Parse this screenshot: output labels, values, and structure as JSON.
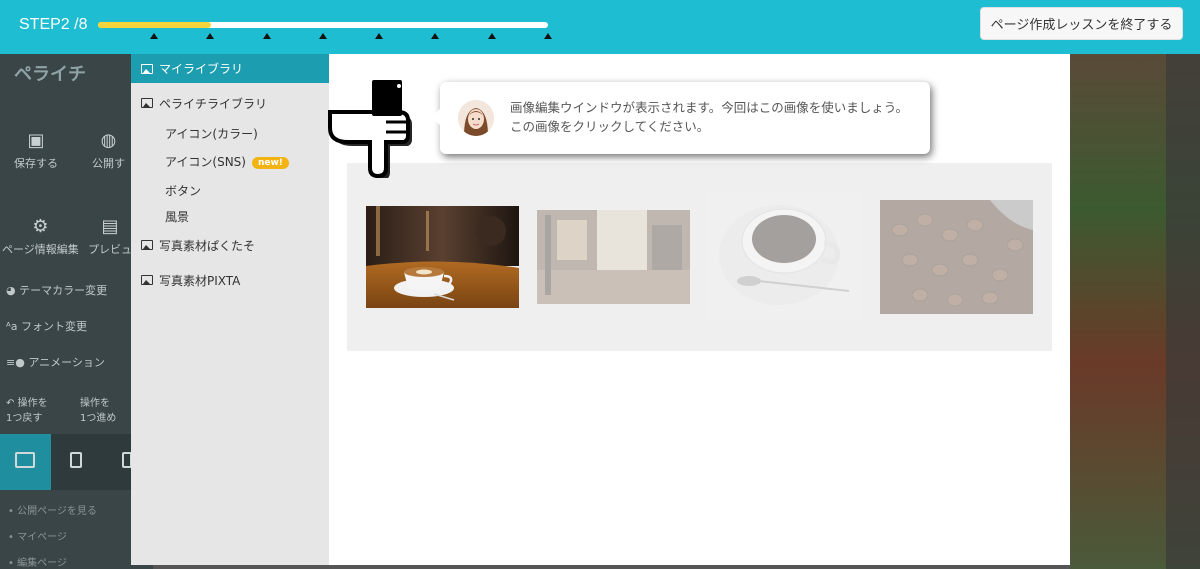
{
  "step_bar": {
    "label": "STEP2 /8",
    "progress": 0.25,
    "step_count": 8,
    "end_lesson_label": "ページ作成レッスンを終了する"
  },
  "background_app": {
    "logo": "ペライチ",
    "save": "保存する",
    "publish": "公開す",
    "page_info": "ページ情報編集",
    "preview": "プレビュ",
    "theme_color": "テーマカラー変更",
    "font": "フォント変更",
    "animation": "アニメーション",
    "undo": "操作を\n1つ戻す",
    "redo": "操作を\n1つ進め",
    "link1": "公開ページを見る",
    "link2": "マイページ",
    "link3": "編集ページ"
  },
  "library": {
    "items": [
      {
        "label": "マイライブラリ",
        "active": true
      },
      {
        "label": "ペライチライブラリ",
        "active": false
      },
      {
        "label": "写真素材ぱくたそ",
        "active": false
      },
      {
        "label": "写真素材PIXTA",
        "active": false
      }
    ],
    "sub_items": [
      {
        "label": "アイコン(カラー)"
      },
      {
        "label": "アイコン(SNS)",
        "badge": "new!"
      },
      {
        "label": "ボタン"
      },
      {
        "label": "風景"
      }
    ]
  },
  "hint": {
    "text": "画像編集ウインドウが表示されます。今回はこの画像を使いましょう。この画像をクリックしてください。"
  },
  "colors": {
    "accent": "#1ebdd1",
    "sidebar_active": "#1c9eb0",
    "progress_fill": "#f5d33b",
    "badge": "#f3b413"
  }
}
